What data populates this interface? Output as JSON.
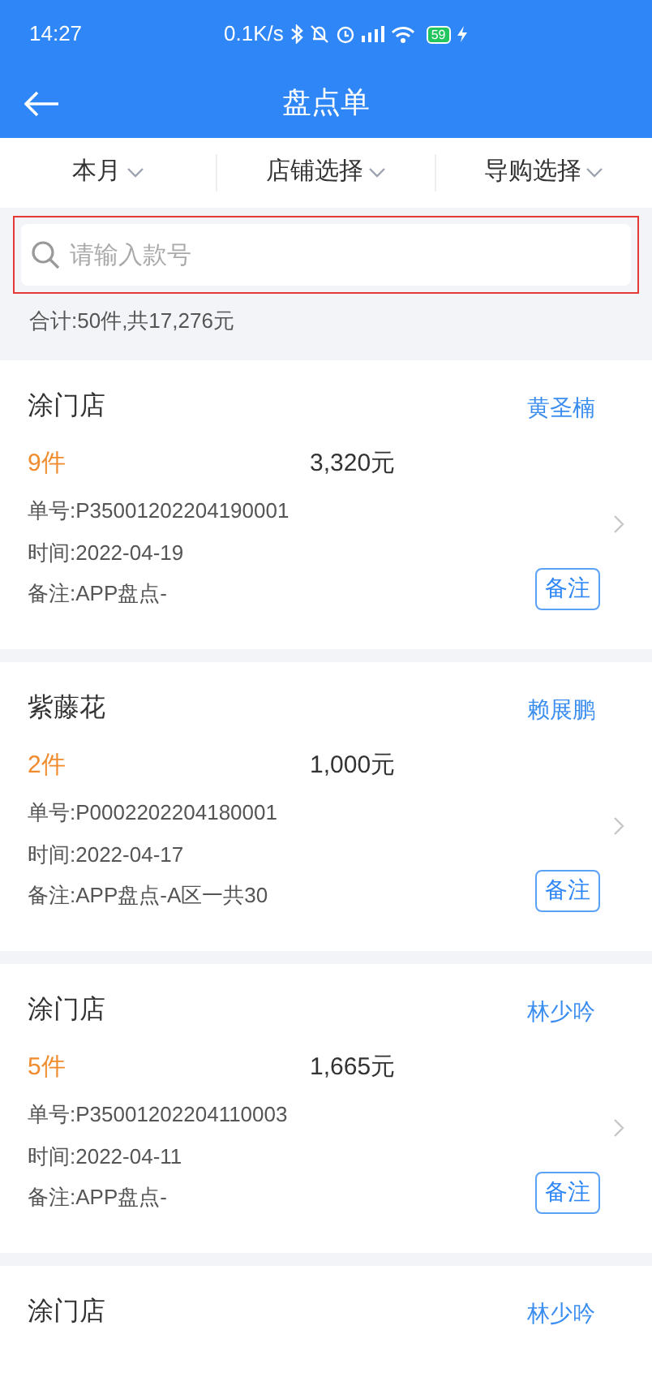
{
  "status_bar": {
    "time": "14:27",
    "net_speed": "0.1K/s",
    "battery": "59"
  },
  "header": {
    "title": "盘点单"
  },
  "filters": [
    {
      "label": "本月"
    },
    {
      "label": "店铺选择"
    },
    {
      "label": "导购选择"
    }
  ],
  "search": {
    "placeholder": "请输入款号",
    "highlighted": true
  },
  "summary": "合计:50件,共17,276元",
  "records": [
    {
      "store": "涂门店",
      "person": "黄圣楠",
      "qty": "9件",
      "amount": "3,320元",
      "order_no": "单号:P35001202204190001",
      "time": "时间:2022-04-19",
      "note": "备注:APP盘点-",
      "remark_button": "备注"
    },
    {
      "store": "紫藤花",
      "person": "赖展鹏",
      "qty": "2件",
      "amount": "1,000元",
      "order_no": "单号:P0002202204180001",
      "time": "时间:2022-04-17",
      "note": "备注:APP盘点-A区一共30",
      "remark_button": "备注"
    },
    {
      "store": "涂门店",
      "person": "林少吟",
      "qty": "5件",
      "amount": "1,665元",
      "order_no": "单号:P35001202204110003",
      "time": "时间:2022-04-11",
      "note": "备注:APP盘点-",
      "remark_button": "备注"
    },
    {
      "store": "涂门店",
      "person": "林少吟"
    }
  ]
}
